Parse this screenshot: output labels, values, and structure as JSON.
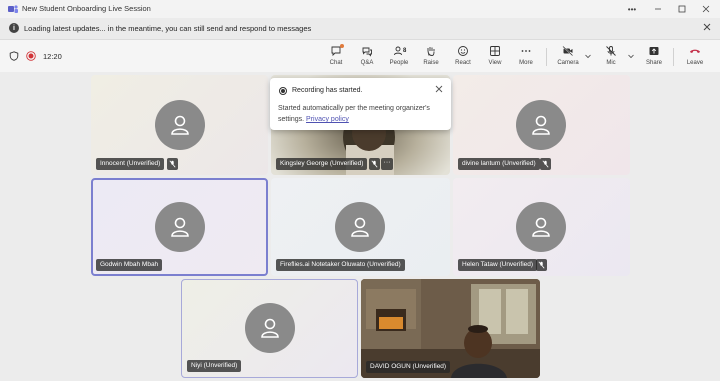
{
  "window": {
    "title": "New Student Onboarding Live Session",
    "controls": [
      "more",
      "minimize",
      "maximize",
      "close"
    ]
  },
  "banner": {
    "icon": "info-icon",
    "text": "Loading latest updates... in the meantime, you can still send and respond to messages"
  },
  "toolbar": {
    "timer": "12:20",
    "buttons": [
      {
        "id": "chat",
        "label": "Chat",
        "icon": "chat-icon"
      },
      {
        "id": "qa",
        "label": "Q&A",
        "icon": "qa-icon"
      },
      {
        "id": "people",
        "label": "People",
        "icon": "people-icon",
        "count": "8"
      },
      {
        "id": "raise",
        "label": "Raise",
        "icon": "hand-icon"
      },
      {
        "id": "react",
        "label": "React",
        "icon": "smiley-icon"
      },
      {
        "id": "view",
        "label": "View",
        "icon": "grid-icon"
      },
      {
        "id": "more",
        "label": "More",
        "icon": "more-icon"
      },
      {
        "id": "camera",
        "label": "Camera",
        "icon": "camera-off-icon"
      },
      {
        "id": "mic",
        "label": "Mic",
        "icon": "mic-off-icon"
      },
      {
        "id": "share",
        "label": "Share",
        "icon": "share-icon"
      },
      {
        "id": "leave",
        "label": "Leave",
        "icon": "phone-hangup-icon"
      }
    ],
    "leave_color": "#c4314b"
  },
  "participants": [
    {
      "name": "Innocent (Unverified)",
      "muted": true,
      "video": false
    },
    {
      "name": "Kingsley George (Unverified)",
      "muted": true,
      "video": true
    },
    {
      "name": "divine lantum (Unverified)",
      "muted": true,
      "video": false
    },
    {
      "name": "Godwin Mbah Mbah",
      "muted": false,
      "video": false,
      "active_speaker": true
    },
    {
      "name": "Fireflies.ai Notetaker Oluwato (Unverified)",
      "muted": false,
      "video": false
    },
    {
      "name": "Helen Tataw (Unverified)",
      "muted": true,
      "video": false
    },
    {
      "name": "Niyi (Unverified)",
      "muted": false,
      "video": false
    },
    {
      "name": "DAVID OGUN (Unverified)",
      "muted": false,
      "video": true
    }
  ],
  "toast": {
    "title": "Recording has started.",
    "body": "Started automatically per the meeting organizer's settings.",
    "link": "Privacy policy"
  },
  "colors": {
    "accent": "#5b5fc7",
    "active_border": "#7b7fcf",
    "recording": "#d13438",
    "avatar": "#8a8a8a"
  }
}
